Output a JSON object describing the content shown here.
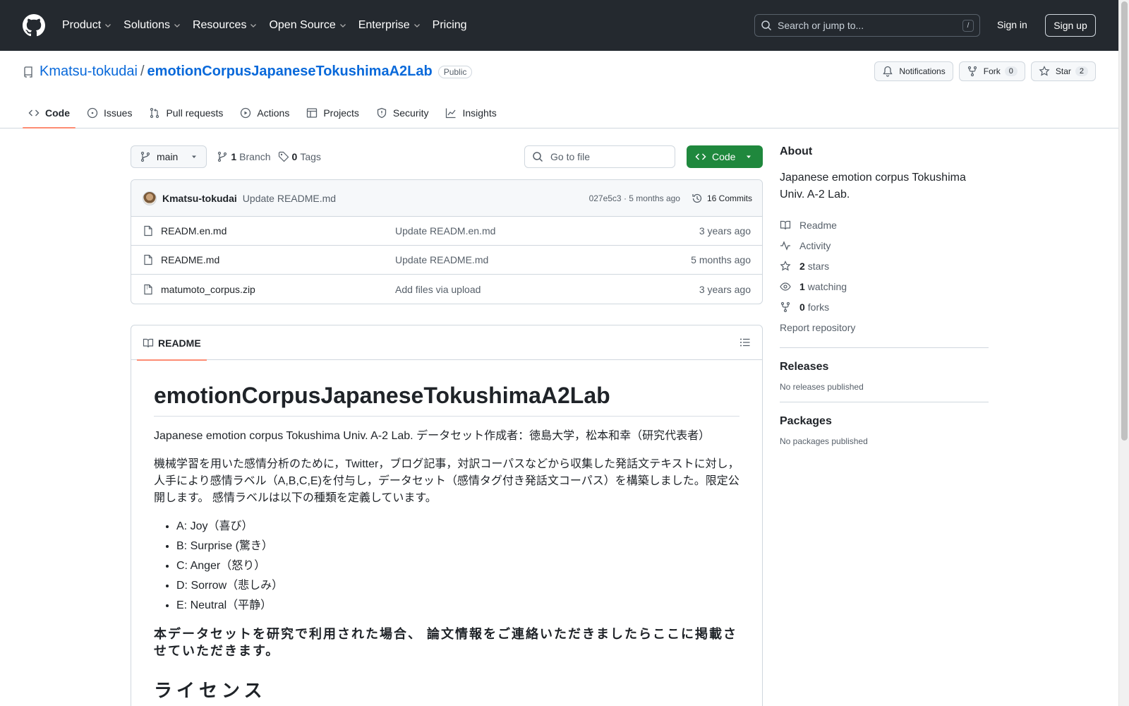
{
  "header": {
    "nav": [
      "Product",
      "Solutions",
      "Resources",
      "Open Source",
      "Enterprise",
      "Pricing"
    ],
    "search_placeholder": "Search or jump to...",
    "search_key": "/",
    "signin": "Sign in",
    "signup": "Sign up"
  },
  "repo": {
    "owner": "Kmatsu-tokudai",
    "sep": "/",
    "name": "emotionCorpusJapaneseTokushimaA2Lab",
    "visibility": "Public",
    "notifications": "Notifications",
    "fork_label": "Fork",
    "fork_count": "0",
    "star_label": "Star",
    "star_count": "2"
  },
  "tabs": [
    "Code",
    "Issues",
    "Pull requests",
    "Actions",
    "Projects",
    "Security",
    "Insights"
  ],
  "toolbar": {
    "branch": "main",
    "branch_count": "1",
    "branch_label": "Branch",
    "tag_count": "0",
    "tag_label": "Tags",
    "goto_placeholder": "Go to file",
    "code_label": "Code"
  },
  "commit": {
    "author": "Kmatsu-tokudai",
    "message": "Update README.md",
    "hash_age": "027e5c3 · 5 months ago",
    "commits": "16 Commits"
  },
  "files": [
    {
      "name": "READM.en.md",
      "message": "Update READM.en.md",
      "age": "3 years ago"
    },
    {
      "name": "README.md",
      "message": "Update README.md",
      "age": "5 months ago"
    },
    {
      "name": "matumoto_corpus.zip",
      "message": "Add files via upload",
      "age": "3 years ago"
    }
  ],
  "readme": {
    "tab": "README",
    "title": "emotionCorpusJapaneseTokushimaA2Lab",
    "p1": "Japanese emotion corpus Tokushima Univ. A-2 Lab. データセット作成者：徳島大学，松本和幸（研究代表者）",
    "p2": "機械学習を用いた感情分析のために，Twitter，ブログ記事，対訳コーパスなどから収集した発話文テキストに対し，人手により感情ラベル（A,B,C,E)を付与し，データセット（感情タグ付き発話文コーパス）を構築しました。限定公開します。 感情ラベルは以下の種類を定義しています。",
    "labels": [
      "A: Joy（喜び）",
      "B: Surprise (驚き）",
      "C: Anger（怒り）",
      "D: Sorrow（悲しみ）",
      "E: Neutral（平静）"
    ],
    "h3": "本データセットを研究で利用された場合、 論文情報をご連絡いただきましたらここに掲載させていただきます。",
    "h2": "ライセンス"
  },
  "about": {
    "title": "About",
    "description": "Japanese emotion corpus Tokushima Univ. A-2 Lab.",
    "readme": "Readme",
    "activity": "Activity",
    "stars_count": "2",
    "stars_label": "stars",
    "watching_count": "1",
    "watching_label": "watching",
    "forks_count": "0",
    "forks_label": "forks",
    "report": "Report repository"
  },
  "releases": {
    "title": "Releases",
    "empty": "No releases published"
  },
  "packages": {
    "title": "Packages",
    "empty": "No packages published"
  },
  "colors": {
    "header_bg": "#24292f",
    "link": "#0969da",
    "code_btn": "#1f883d",
    "tab_underline": "#fd8c73"
  }
}
